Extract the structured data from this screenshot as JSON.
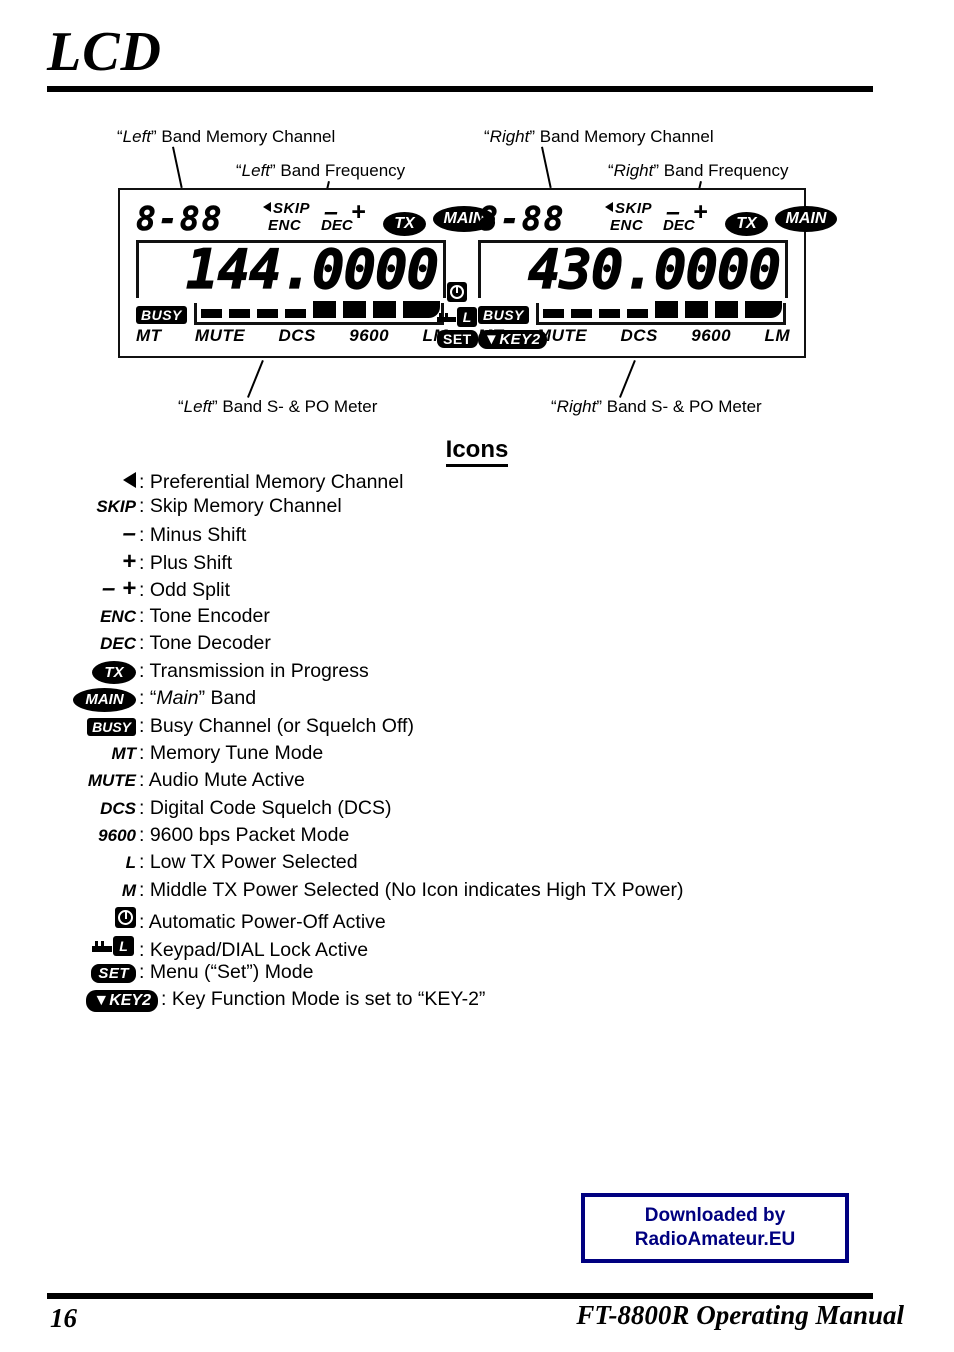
{
  "header": {
    "title": "LCD"
  },
  "callouts": {
    "left_mem": {
      "pre": "“",
      "em": "Left",
      "post": "” Band Memory Channel"
    },
    "left_freq": {
      "pre": "“",
      "em": "Left",
      "post": "” Band Frequency"
    },
    "right_mem": {
      "pre": "“",
      "em": "Right",
      "post": "” Band Memory Channel"
    },
    "right_freq": {
      "pre": "“",
      "em": "Right",
      "post": "” Band Frequency"
    },
    "left_meter": {
      "pre": "“",
      "em": "Left",
      "post": "” Band S- & PO Meter"
    },
    "right_meter": {
      "pre": "“",
      "em": "Right",
      "post": "” Band S- & PO Meter"
    }
  },
  "lcd": {
    "left": {
      "memory_channel": "8-88",
      "skip": "SKIP",
      "enc": "ENC",
      "dec": "DEC",
      "shift": "– +",
      "tx": "TX",
      "main": "MAIN",
      "frequency": "144.0000",
      "busy": "BUSY",
      "legend": [
        "MT",
        "MUTE",
        "DCS",
        "9600",
        "LM"
      ],
      "meter_bars": [
        {
          "type": "small"
        },
        {
          "type": "small"
        },
        {
          "type": "small"
        },
        {
          "type": "small"
        },
        {
          "type": "tall"
        },
        {
          "type": "tall"
        },
        {
          "type": "tall"
        },
        {
          "type": "tall"
        },
        {
          "type": "tall-end"
        }
      ]
    },
    "right": {
      "memory_channel": "8-88",
      "skip": "SKIP",
      "enc": "ENC",
      "dec": "DEC",
      "shift": "– +",
      "tx": "TX",
      "main": "MAIN",
      "frequency": "430.0000",
      "busy": "BUSY",
      "legend": [
        "MT",
        "MUTE",
        "DCS",
        "9600",
        "LM"
      ],
      "meter_bars": [
        {
          "type": "small"
        },
        {
          "type": "small"
        },
        {
          "type": "small"
        },
        {
          "type": "small"
        },
        {
          "type": "tall"
        },
        {
          "type": "tall"
        },
        {
          "type": "tall"
        },
        {
          "type": "tall"
        },
        {
          "type": "tall-end"
        }
      ]
    },
    "center": {
      "set": "SET",
      "key2": "▼KEY2",
      "lock_letter": "L"
    }
  },
  "icons_section": {
    "heading": "Icons",
    "items": [
      {
        "glyph_kind": "triangle-left",
        "glyph_text": "",
        "desc_pre": ": Preferential Memory Channel",
        "desc_em": "",
        "desc_post": ""
      },
      {
        "glyph_kind": "text",
        "glyph_text": "SKIP",
        "desc_pre": " : Skip Memory Channel",
        "desc_em": "",
        "desc_post": ""
      },
      {
        "glyph_kind": "minus",
        "glyph_text": "–",
        "desc_pre": ": Minus Shift",
        "desc_em": "",
        "desc_post": ""
      },
      {
        "glyph_kind": "plus",
        "glyph_text": "+",
        "desc_pre": ": Plus Shift",
        "desc_em": "",
        "desc_post": ""
      },
      {
        "glyph_kind": "minusplus",
        "glyph_text": "– +",
        "desc_pre": ": Odd Split",
        "desc_em": "",
        "desc_post": ""
      },
      {
        "glyph_kind": "text",
        "glyph_text": "ENC",
        "desc_pre": ": Tone Encoder",
        "desc_em": "",
        "desc_post": ""
      },
      {
        "glyph_kind": "text",
        "glyph_text": "DEC",
        "desc_pre": ": Tone Decoder",
        "desc_em": "",
        "desc_post": ""
      },
      {
        "glyph_kind": "ellipse-tx",
        "glyph_text": "TX",
        "desc_pre": ": Transmission in Progress",
        "desc_em": "",
        "desc_post": ""
      },
      {
        "glyph_kind": "ellipse-main",
        "glyph_text": "MAIN",
        "desc_pre": ": “",
        "desc_em": "Main",
        "desc_post": "” Band"
      },
      {
        "glyph_kind": "badge-busy",
        "glyph_text": "BUSY",
        "desc_pre": " : Busy Channel (or Squelch Off)",
        "desc_em": "",
        "desc_post": ""
      },
      {
        "glyph_kind": "text",
        "glyph_text": "MT",
        "desc_pre": " : Memory Tune Mode",
        "desc_em": "",
        "desc_post": ""
      },
      {
        "glyph_kind": "text",
        "glyph_text": "MUTE",
        "desc_pre": ": Audio Mute Active",
        "desc_em": "",
        "desc_post": ""
      },
      {
        "glyph_kind": "text",
        "glyph_text": "DCS",
        "desc_pre": ": Digital Code Squelch (DCS)",
        "desc_em": "",
        "desc_post": ""
      },
      {
        "glyph_kind": "text",
        "glyph_text": "9600",
        "desc_pre": ": 9600 bps Packet Mode",
        "desc_em": "",
        "desc_post": ""
      },
      {
        "glyph_kind": "text",
        "glyph_text": "L",
        "desc_pre": ": Low TX Power Selected",
        "desc_em": "",
        "desc_post": ""
      },
      {
        "glyph_kind": "text",
        "glyph_text": "M",
        "desc_pre": ": Middle TX Power Selected (No Icon indicates High TX Power)",
        "desc_em": "",
        "desc_post": ""
      },
      {
        "glyph_kind": "apo",
        "glyph_text": "",
        "desc_pre": ": Automatic Power-Off Active",
        "desc_em": "",
        "desc_post": ""
      },
      {
        "glyph_kind": "lock",
        "glyph_text": "L",
        "desc_pre": ": Keypad/DIAL Lock Active",
        "desc_em": "",
        "desc_post": ""
      },
      {
        "glyph_kind": "badge-set",
        "glyph_text": "SET",
        "desc_pre": ": Menu (“Set”) Mode",
        "desc_em": "",
        "desc_post": ""
      },
      {
        "glyph_kind": "badge-key2",
        "glyph_text": "▼KEY2",
        "desc_pre": " : Key Function Mode is set to “KEY-2”",
        "desc_em": "",
        "desc_post": ""
      }
    ]
  },
  "download_box": {
    "line1": "Downloaded by",
    "line2": "RadioAmateur.EU",
    "color": "#000080"
  },
  "footer": {
    "page_number": "16",
    "manual_title": "FT-8800R Operating Manual"
  }
}
